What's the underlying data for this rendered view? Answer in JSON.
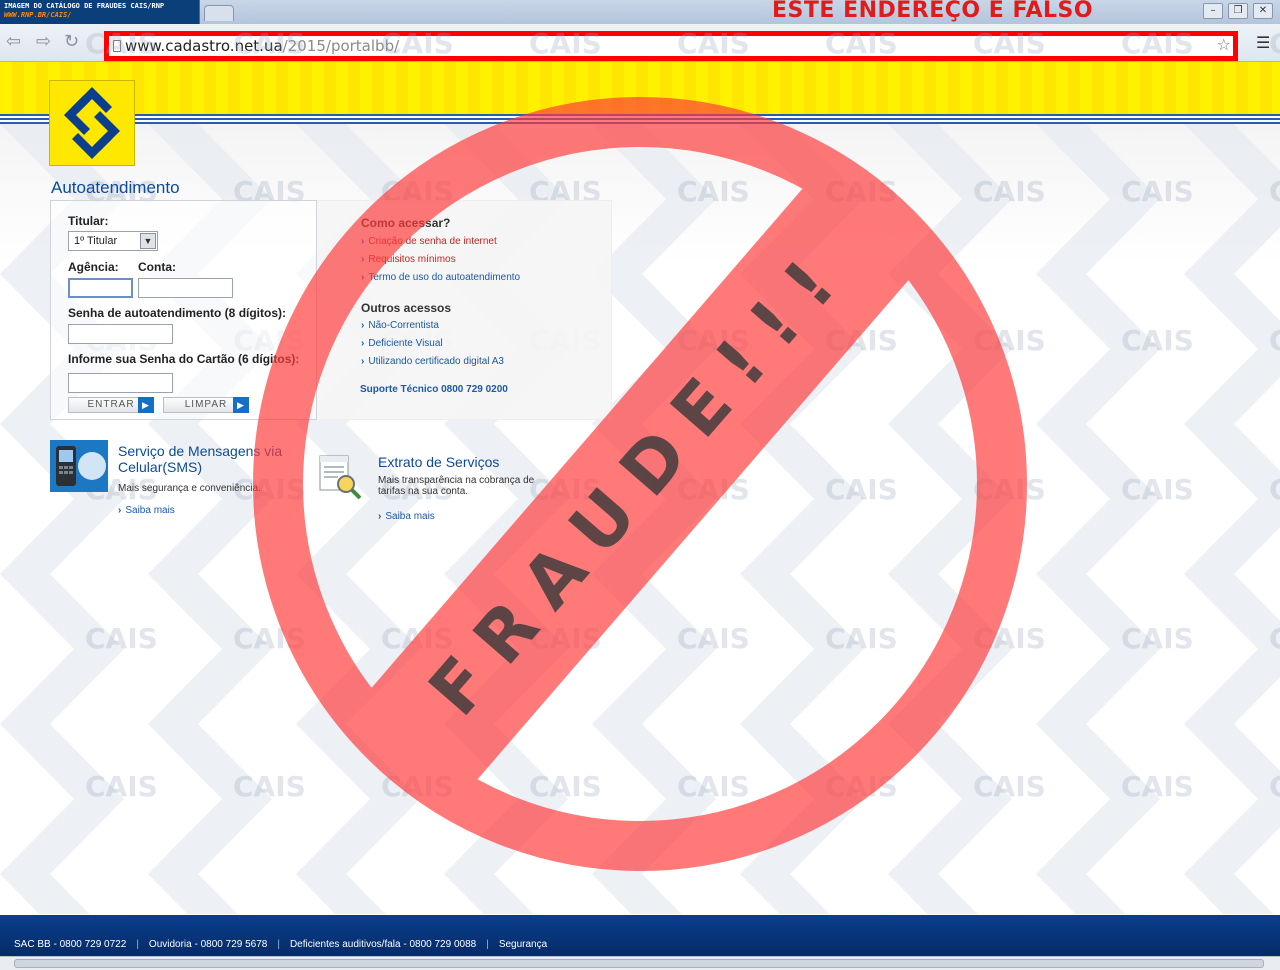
{
  "catalog_banner": {
    "line1": "IMAGEM DO CATÁLOGO DE FRAUDES CAIS/RNP",
    "line2": "WWW.RNP.BR/CAIS/"
  },
  "warning": {
    "text": "ESTE ENDEREÇO É FALSO"
  },
  "address_bar": {
    "host": "www.cadastro.net.ua",
    "path": "/2015/portalbb/"
  },
  "watermark": {
    "text": "CAIS"
  },
  "stamp": {
    "text": "FRAUDE!!!"
  },
  "page": {
    "title": "Autoatendimento"
  },
  "login": {
    "titular_label": "Titular:",
    "titular_value": "1º Titular",
    "agencia_label": "Agência:",
    "conta_label": "Conta:",
    "senha_label": "Senha de autoatendimento (8 dígitos):",
    "cartao_label": "Informe sua Senha do Cartão (6 dígitos):",
    "entrar": "ENTRAR",
    "limpar": "LIMPAR"
  },
  "help": {
    "como_heading": "Como acessar?",
    "como_links": [
      "Criação de senha de internet",
      "Requisitos mínimos",
      "Termo de uso do autoatendimento"
    ],
    "outros_heading": "Outros acessos",
    "outros_links": [
      "Não-Correntista",
      "Deficiente Visual",
      "Utilizando certificado digital A3"
    ],
    "suporte": "Suporte Técnico 0800 729 0200"
  },
  "promos": [
    {
      "title": "Serviço de Mensagens via Celular(SMS)",
      "desc": "Mais segurança e conveniência.",
      "link": "Saiba mais"
    },
    {
      "title": "Extrato de Serviços",
      "desc": "Mais transparência na cobrança de tarifas na sua conta.",
      "link": "Saiba mais"
    }
  ],
  "footer": {
    "sac": "SAC BB - 0800 729 0722",
    "ouvidoria": "Ouvidoria - 0800 729 5678",
    "deficientes": "Deficientes auditivos/fala - 0800 729 0088",
    "seguranca": "Segurança"
  },
  "colors": {
    "bb_yellow": "#fff100",
    "bb_blue": "#0b4a9c",
    "fraud_red": "#ff4040",
    "warning_red": "#e11b1b"
  }
}
